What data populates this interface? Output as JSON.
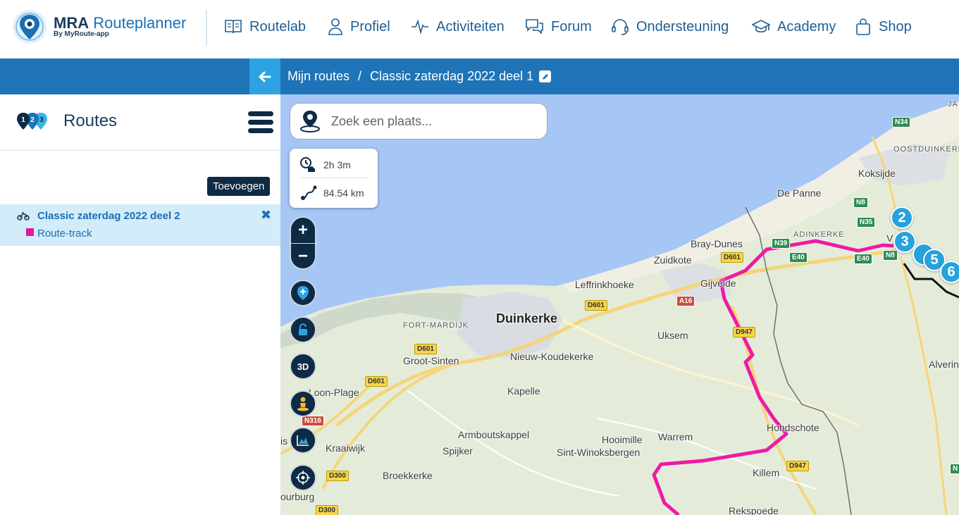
{
  "app": {
    "name_bold": "MRA",
    "name_light": " Routeplanner",
    "tagline": "By MyRoute-app"
  },
  "nav": {
    "items": [
      {
        "label": "Routelab",
        "icon": "book-icon"
      },
      {
        "label": "Profiel",
        "icon": "user-icon"
      },
      {
        "label": "Activiteiten",
        "icon": "pulse-icon"
      },
      {
        "label": "Forum",
        "icon": "chat-icon"
      },
      {
        "label": "Ondersteuning",
        "icon": "headset-icon"
      },
      {
        "label": "Academy",
        "icon": "graduation-cap-icon"
      },
      {
        "label": "Shop",
        "icon": "shopping-bag-icon"
      }
    ]
  },
  "breadcrumb": {
    "parent": "Mijn routes",
    "separator": "/",
    "current": "Classic zaterdag 2022 deel 1"
  },
  "sidebar": {
    "title": "Routes",
    "routes_icon_numbers": [
      "1",
      "2",
      "3"
    ],
    "add_label": "Toevoegen",
    "route": {
      "name": "Classic zaterdag 2022 deel 2",
      "track_label": "Route-track",
      "track_color": "#e6179c"
    }
  },
  "map": {
    "search_placeholder": "Zoek een plaats...",
    "stats": {
      "duration": "2h 3m",
      "distance": "84.54 km"
    },
    "zoom_in": "+",
    "zoom_out": "−",
    "controls": [
      "add-waypoint-icon",
      "lock-icon",
      "3D",
      "street-view-icon",
      "elevation-chart-icon",
      "locate-icon"
    ],
    "three_d_label": "3D",
    "places": {
      "duinkerke": "Duinkerke",
      "fort_mardijk": "FORT-MARDIJK",
      "groot_sinten": "Groot-Sinten",
      "nieuw_koudekerke": "Nieuw-Koudekerke",
      "leffrinkhoeke": "Leffrinkhoeke",
      "zuidkote": "Zuidkote",
      "bray_dunes": "Bray-Dunes",
      "gijvelde": "Gijvelde",
      "uksem": "Uksem",
      "kapelle": "Kapelle",
      "loon_plage": "Loon-Plage",
      "armboutskappel": "Armboutskappel",
      "spijker": "Spijker",
      "kraaiwijk": "Kraaiwijk",
      "hooimille": "Hooimille",
      "warrem": "Warrem",
      "sint_winoksbergen": "Sint-Winoksbergen",
      "hondschote": "Hondschote",
      "killem": "Killem",
      "broekkerke": "Broekkerke",
      "rekspoede": "Rekspoede",
      "bourbourg": "ourburg",
      "is": "is",
      "de_panne": "De Panne",
      "koksijde": "Koksijde",
      "oostduinkerke": "OOSTDUINKERK",
      "adinkerke": "ADINKERKE",
      "alveringem": "Alverin",
      "ja": "JA",
      "v": "V"
    },
    "roads": {
      "n34": "N34",
      "n8a": "N8",
      "n35": "N35",
      "n39": "N39",
      "e40a": "E40",
      "e40b": "E40",
      "n8b": "N8",
      "d601a": "D601",
      "d601b": "D601",
      "d601c": "D601",
      "d601d": "D601",
      "a16": "A16",
      "d947a": "D947",
      "d947b": "D947",
      "n316": "N316",
      "d300a": "D300",
      "d300b": "D300",
      "n_edge": "N"
    },
    "markers": [
      "2",
      "3",
      "5",
      "6"
    ]
  }
}
